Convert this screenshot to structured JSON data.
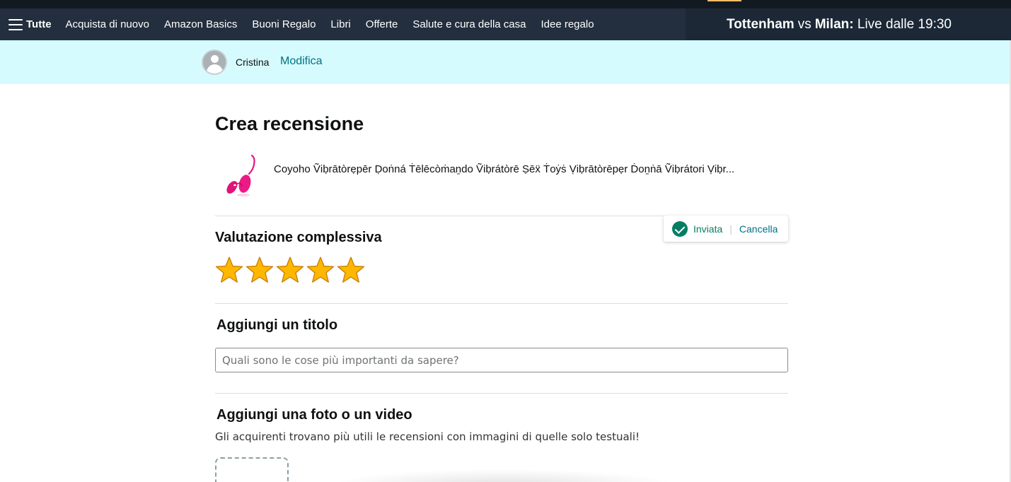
{
  "nav": {
    "all_label": "Tutte",
    "links": [
      "Acquista di nuovo",
      "Amazon Basics",
      "Buoni Regalo",
      "Libri",
      "Offerte",
      "Salute e cura della casa",
      "Idee regalo"
    ],
    "promo": {
      "team_a": "Tottenham",
      "vs": "vs",
      "team_b": "Milan:",
      "time_text": "Live dalle 19:30"
    }
  },
  "profile": {
    "name": "Cristina",
    "edit_label": "Modifica"
  },
  "page": {
    "title": "Crea recensione",
    "product_title": "Coyoho Ṽiḅrātòrẹpēr Ḍoṅná Ṫēlēcòṁaṉdo Ṽiḅrátòrē Ṣēẍ Ṫoẏṡ Ṿiḅrātòrēpẹr Ḋoṉṅā Ṽiḅrátori Ṿiḅr..."
  },
  "rating": {
    "heading": "Valutazione complessiva",
    "value": 5,
    "max": 5,
    "sent_label": "Inviata",
    "separator": "|",
    "cancel_label": "Cancella"
  },
  "title_section": {
    "heading": "Aggiungi un titolo",
    "placeholder": "Quali sono le cose più importanti da sapere?"
  },
  "media_section": {
    "heading": "Aggiungi una foto o un video",
    "subtitle": "Gli acquirenti trovano più utili le recensioni con immagini di quelle solo testuali!"
  },
  "colors": {
    "nav_bg": "#232f3e",
    "profile_bg": "#d6fbff",
    "link": "#007185",
    "success": "#067d62",
    "star": "#ffb700"
  }
}
